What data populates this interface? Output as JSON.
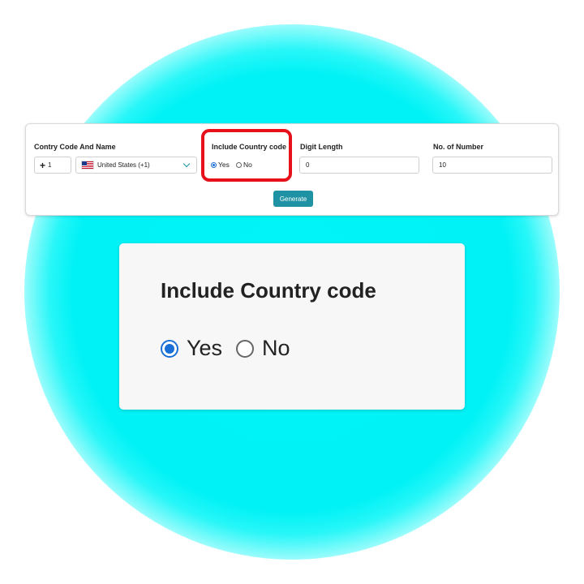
{
  "form": {
    "country_code_label": "Contry Code And Name",
    "country_code_prefix": "+",
    "country_code_value": "1",
    "country_select_value": "United States (+1)",
    "country_flag_icon": "us-flag-icon",
    "include_country_code_label": "Include Country code",
    "include_options": [
      {
        "label": "Yes",
        "selected": true
      },
      {
        "label": "No",
        "selected": false
      }
    ],
    "digit_length_label": "Digit Length",
    "digit_length_value": "0",
    "no_of_number_label": "No. of Number",
    "no_of_number_value": "10",
    "generate_label": "Generate"
  },
  "zoom": {
    "title": "Include Country code",
    "yes_label": "Yes",
    "no_label": "No",
    "selected": "Yes"
  },
  "colors": {
    "glow": "#00f2f6",
    "highlight": "#e8111b",
    "radio_accent": "#1a6fd6",
    "button": "#1f93a3"
  }
}
